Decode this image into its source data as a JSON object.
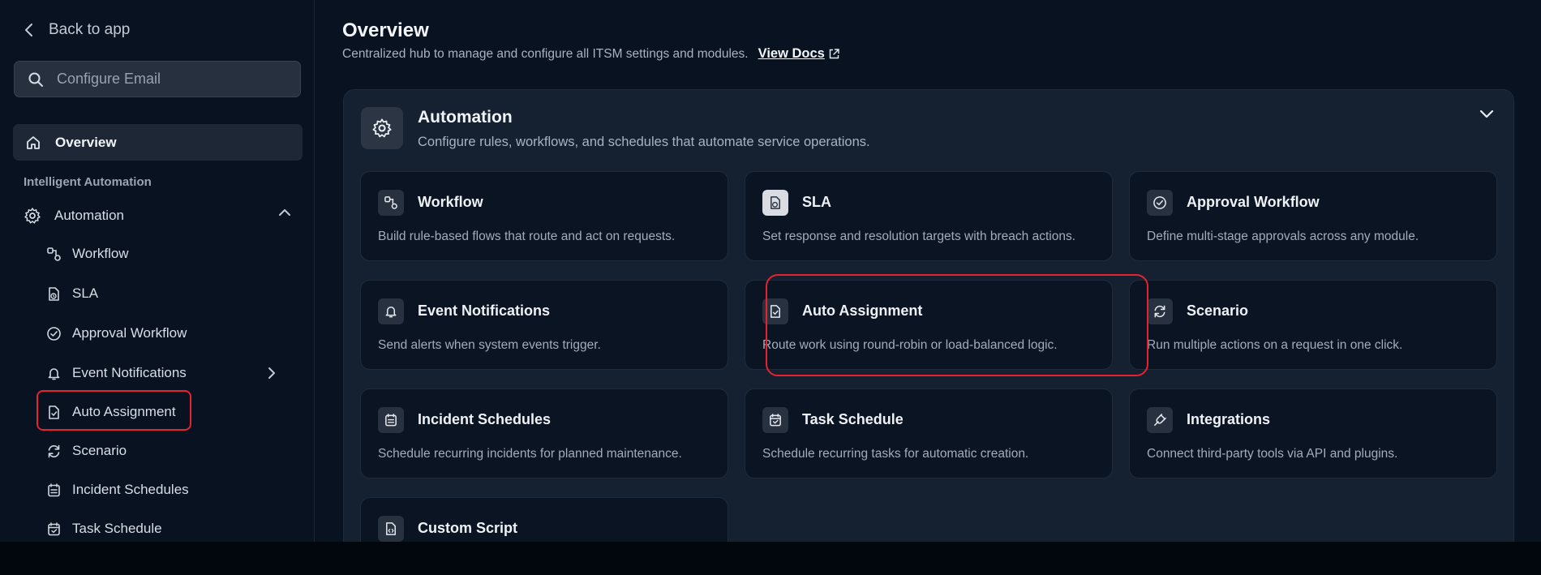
{
  "sidebar": {
    "back_label": "Back to app",
    "search": {
      "value": "",
      "placeholder": "Configure Email"
    },
    "overview_label": "Overview",
    "section_label": "Intelligent Automation",
    "group_label": "Automation",
    "items": [
      {
        "label": "Workflow"
      },
      {
        "label": "SLA"
      },
      {
        "label": "Approval Workflow"
      },
      {
        "label": "Event Notifications"
      },
      {
        "label": "Auto Assignment"
      },
      {
        "label": "Scenario"
      },
      {
        "label": "Incident Schedules"
      },
      {
        "label": "Task Schedule"
      }
    ]
  },
  "header": {
    "title": "Overview",
    "subtitle": "Centralized hub to manage and configure all ITSM settings and modules.",
    "docs_link": "View Docs"
  },
  "panel": {
    "title": "Automation",
    "description": "Configure rules, workflows, and schedules that automate service operations.",
    "cards": [
      {
        "title": "Workflow",
        "desc": "Build rule-based flows that route and act on requests."
      },
      {
        "title": "SLA",
        "desc": "Set response and resolution targets with breach actions."
      },
      {
        "title": "Approval Workflow",
        "desc": "Define multi-stage approvals across any module."
      },
      {
        "title": "Event Notifications",
        "desc": "Send alerts when system events trigger."
      },
      {
        "title": "Auto Assignment",
        "desc": "Route work using round-robin or load-balanced logic."
      },
      {
        "title": "Scenario",
        "desc": "Run multiple actions on a request in one click."
      },
      {
        "title": "Incident Schedules",
        "desc": "Schedule recurring incidents for planned maintenance."
      },
      {
        "title": "Task Schedule",
        "desc": "Schedule recurring tasks for automatic creation."
      },
      {
        "title": "Integrations",
        "desc": "Connect third-party tools via API and plugins."
      },
      {
        "title": "Custom Script",
        "desc": ""
      }
    ]
  },
  "colors": {
    "background": "#081221",
    "panel": "#152131",
    "card": "#0b1422",
    "highlight": "#e8222f"
  },
  "icons": [
    "chevron-left-icon",
    "search-icon",
    "home-icon",
    "gear-icon",
    "chevron-up-icon",
    "workflow-icon",
    "file-clock-icon",
    "check-circle-icon",
    "bell-icon",
    "chevron-right-icon",
    "file-user-icon",
    "refresh-icon",
    "calendar-list-icon",
    "calendar-check-icon",
    "plug-icon",
    "file-code-icon",
    "external-link-icon",
    "chevron-down-icon"
  ]
}
